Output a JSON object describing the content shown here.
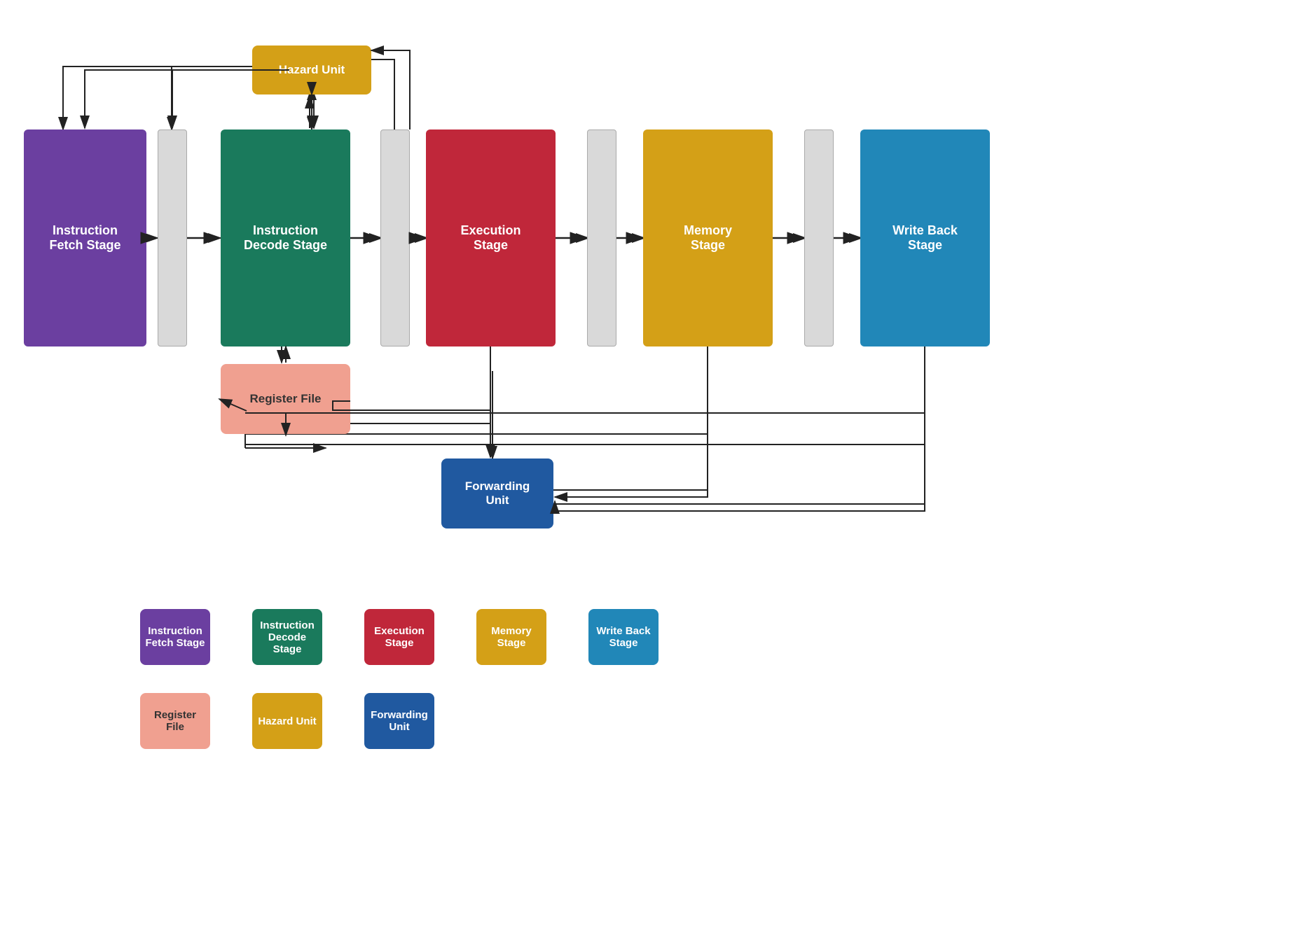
{
  "colors": {
    "instruction_fetch": "#6b3fa0",
    "instruction_decode": "#1a7a5c",
    "execution": "#c0273a",
    "memory": "#d4a017",
    "write_back": "#2187b8",
    "register_file": "#f0a090",
    "hazard_unit": "#d4a017",
    "forwarding_unit": "#2059a0",
    "pipeline_reg": "#d9d9d9",
    "arrow": "#222222"
  },
  "blocks": {
    "fetch": {
      "label": "Instruction\nFetch Stage"
    },
    "decode": {
      "label": "Instruction\nDecode Stage"
    },
    "execute": {
      "label": "Execution\nStage"
    },
    "memory": {
      "label": "Memory\nStage"
    },
    "writeback": {
      "label": "Write Back\nStage"
    },
    "register_file": {
      "label": "Register File"
    },
    "hazard_unit": {
      "label": "Hazard Unit"
    },
    "forwarding_unit": {
      "label": "Forwarding\nUnit"
    }
  },
  "legend": {
    "row1": [
      {
        "key": "fetch",
        "label": "Instruction\nFetch Stage",
        "color": "#6b3fa0"
      },
      {
        "key": "decode",
        "label": "Instruction\nDecode Stage",
        "color": "#1a7a5c"
      },
      {
        "key": "execute",
        "label": "Execution\nStage",
        "color": "#c0273a"
      },
      {
        "key": "memory",
        "label": "Memory\nStage",
        "color": "#d4a017"
      },
      {
        "key": "writeback",
        "label": "Write Back\nStage",
        "color": "#2187b8"
      }
    ],
    "row2": [
      {
        "key": "register_file",
        "label": "Register File",
        "color": "#f0a090"
      },
      {
        "key": "hazard",
        "label": "Hazard Unit",
        "color": "#d4a017"
      },
      {
        "key": "forwarding",
        "label": "Forwarding\nUnit",
        "color": "#2059a0"
      }
    ]
  }
}
